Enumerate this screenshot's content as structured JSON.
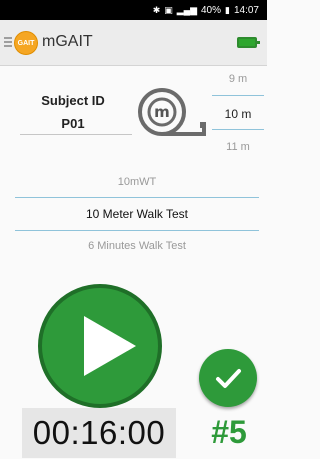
{
  "status_bar": {
    "bluetooth_icon": "bluetooth-icon",
    "nfc_icon": "nfc-icon",
    "signal_icon": "signal-icon",
    "battery_percent": "40%",
    "battery_icon": "battery-icon",
    "time": "14:07"
  },
  "app_bar": {
    "menu_icon": "menu-icon",
    "logo_text": "GAIT",
    "title": "mGAIT",
    "battery_status_icon": "battery-full-icon",
    "battery_color": "#2ea62e"
  },
  "subject": {
    "label": "Subject ID",
    "value": "P01"
  },
  "tape_icon": "measuring-tape-icon",
  "distances": {
    "items": [
      "9 m",
      "10 m",
      "11 m"
    ],
    "selected": "10 m"
  },
  "tests": {
    "items": [
      "10mWT",
      "10 Meter Walk Test",
      "6 Minutes Walk Test"
    ],
    "selected": "10 Meter Walk Test"
  },
  "controls": {
    "play_icon": "play-icon",
    "check_icon": "check-icon",
    "accent_color": "#2e9a3a"
  },
  "timer": "00:16:00",
  "counter": "#5"
}
